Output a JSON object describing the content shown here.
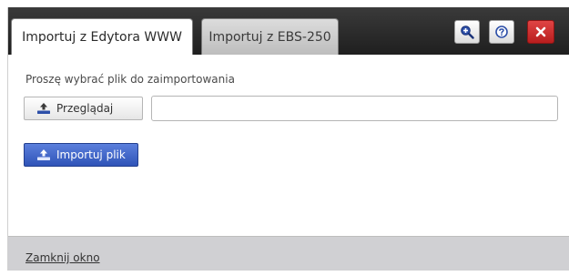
{
  "tabs": [
    {
      "label": "Importuj z Edytora WWW",
      "active": true
    },
    {
      "label": "Importuj z EBS-250",
      "active": false
    }
  ],
  "header_buttons": {
    "zoom_icon": "zoom-in-icon",
    "help_icon": "help-icon",
    "close_icon": "close-icon"
  },
  "form": {
    "prompt": "Proszę wybrać plik do zaimportowania",
    "browse_label": "Przeglądaj",
    "file_value": "",
    "import_label": "Importuj plik",
    "browse_icon": "upload-icon",
    "import_icon": "upload-icon"
  },
  "footer": {
    "close_link": "Zamknij okno"
  },
  "colors": {
    "header_background": "#2a2a2a",
    "close_button": "#c72b2b",
    "import_button": "#3f63c8",
    "footer_background": "#d0d0d3"
  }
}
